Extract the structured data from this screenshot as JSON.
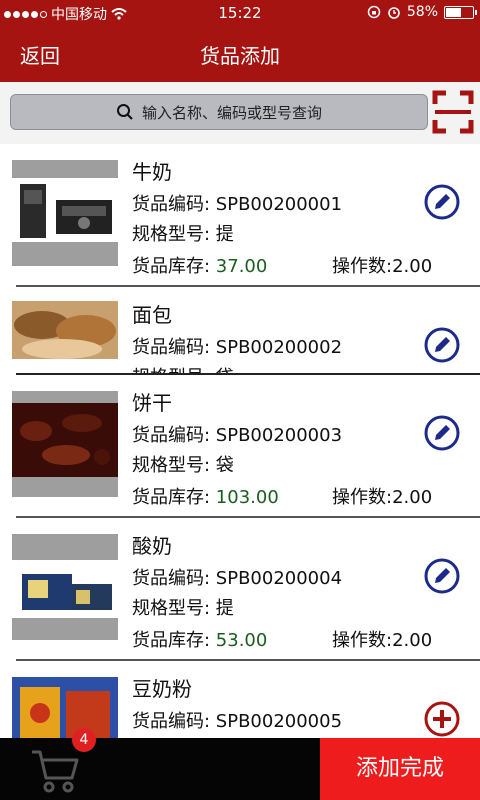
{
  "status_bar": {
    "carrier": "中国移动",
    "time": "15:22",
    "battery": "58%",
    "battery_level": 0.58
  },
  "nav": {
    "back_label": "返回",
    "title": "货品添加"
  },
  "search": {
    "placeholder": "输入名称、编码或型号查询"
  },
  "labels": {
    "code": "货品编码: ",
    "spec": "规格型号: ",
    "stock": "货品库存: ",
    "ops": "操作数:"
  },
  "items": [
    {
      "name": "牛奶",
      "code": "SPB00200001",
      "spec": "提",
      "stock": "37.00",
      "ops": "2.00",
      "action": "edit-icon"
    },
    {
      "name": "面包",
      "code": "SPB00200002",
      "spec": "袋",
      "stock": "",
      "ops": "",
      "action": "edit-icon"
    },
    {
      "name": "饼干",
      "code": "SPB00200003",
      "spec": "袋",
      "stock": "103.00",
      "ops": "2.00",
      "action": "edit-icon"
    },
    {
      "name": "酸奶",
      "code": "SPB00200004",
      "spec": "提",
      "stock": "53.00",
      "ops": "2.00",
      "action": "edit-icon"
    },
    {
      "name": "豆奶粉",
      "code": "SPB00200005",
      "spec": "",
      "stock": "",
      "ops": "",
      "action": "add-icon"
    }
  ],
  "cart": {
    "badge_count": "4"
  },
  "done_button": "添加完成",
  "colors": {
    "header_red": "#a61412",
    "done_red": "#ee1c1c",
    "icon_blue": "#1c2a8a",
    "add_red": "#a61412"
  }
}
